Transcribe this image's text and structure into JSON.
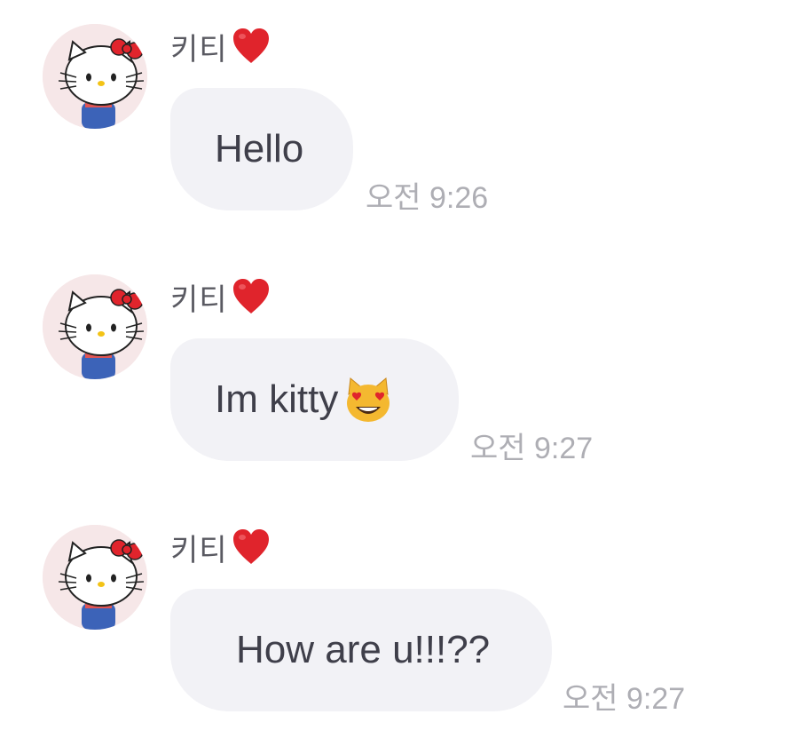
{
  "messages": [
    {
      "sender": "키티",
      "sender_icon": "red-heart-icon",
      "avatar": "hello-kitty-avatar",
      "text": "Hello",
      "text_icon": null,
      "time": "오전 9:26"
    },
    {
      "sender": "키티",
      "sender_icon": "red-heart-icon",
      "avatar": "hello-kitty-avatar",
      "text": "Im kitty",
      "text_icon": "heart-eyes-cat-icon",
      "time": "오전 9:27"
    },
    {
      "sender": "키티",
      "sender_icon": "red-heart-icon",
      "avatar": "hello-kitty-avatar",
      "text": "How are u!!!??",
      "text_icon": null,
      "time": "오전 9:27"
    }
  ],
  "colors": {
    "bubble": "#f2f2f6",
    "text": "#3f3f4a",
    "name": "#5a5a62",
    "time": "#aeaeb4",
    "avatar_bg": "#f6e7e8",
    "heart": "#e0242c"
  }
}
